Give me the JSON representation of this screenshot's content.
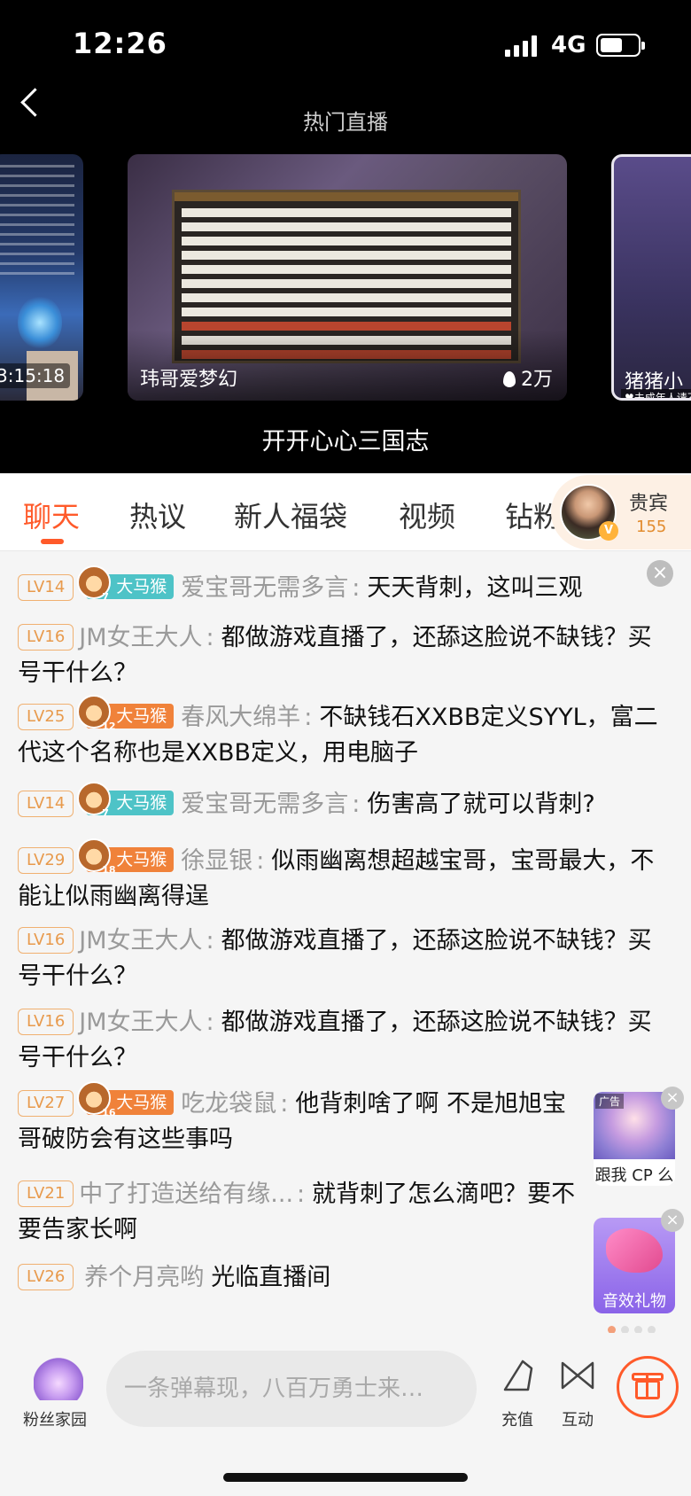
{
  "status_bar": {
    "time": "12:26",
    "network": "4G",
    "battery_level": 0.6
  },
  "header": {
    "title": "热门直播"
  },
  "carousel": {
    "left_card": {
      "timer": "3:15:18"
    },
    "main_card": {
      "streamer": "玮哥爱梦幻",
      "heat": "2万"
    },
    "right_card": {
      "streamer": "猪猪小",
      "badge": "♥未成年人请不"
    },
    "room_title": "开开心心三国志"
  },
  "tabs": [
    {
      "label": "聊天",
      "active": true
    },
    {
      "label": "热议"
    },
    {
      "label": "新人福袋"
    },
    {
      "label": "视频"
    },
    {
      "label": "钻粉"
    }
  ],
  "vip": {
    "label": "贵宾",
    "count": "155"
  },
  "chat": {
    "messages": [
      {
        "level": "LV14",
        "fan_badge": "大马猴",
        "fan_level": "7",
        "nick": "爱宝哥无需多言",
        "text": "天天背刺，这叫三观"
      },
      {
        "level": "LV16",
        "nick": "JM女王大人",
        "text": "都做游戏直播了，还舔这脸说不缺钱？买号干什么？"
      },
      {
        "level": "LV25",
        "fan_badge": "大马猴",
        "fan_level": "12",
        "nick": "春风大绵羊",
        "text": "不缺钱石XXBB定义SYYL，富二代这个名称也是XXBB定义，用电脑子"
      },
      {
        "level": "LV14",
        "fan_badge": "大马猴",
        "fan_level": "7",
        "nick": "爱宝哥无需多言",
        "text": "伤害高了就可以背刺?"
      },
      {
        "level": "LV29",
        "fan_badge": "大马猴",
        "fan_level": "18",
        "nick": "徐显银",
        "text": "似雨幽离想超越宝哥，宝哥最大，不能让似雨幽离得逞"
      },
      {
        "level": "LV16",
        "nick": "JM女王大人",
        "text": "都做游戏直播了，还舔这脸说不缺钱？买号干什么？"
      },
      {
        "level": "LV16",
        "nick": "JM女王大人",
        "text": "都做游戏直播了，还舔这脸说不缺钱？买号干什么？"
      },
      {
        "level": "LV27",
        "fan_badge": "大马猴",
        "fan_level": "16",
        "nick": "吃龙袋鼠",
        "text": "他背刺啥了啊 不是旭旭宝哥破防会有这些事吗"
      },
      {
        "level": "LV21",
        "nick": "中了打造送给有缘...",
        "text": "就背刺了怎么滴吧？要不要告家长啊"
      },
      {
        "level": "LV26",
        "nick": "养个月亮哟",
        "text": "光临直播间"
      }
    ]
  },
  "ads": [
    {
      "tag": "广告",
      "caption": "跟我 CP 么"
    },
    {
      "caption": "音效礼物"
    }
  ],
  "bottom_bar": {
    "fans_home_label": "粉丝家园",
    "input_placeholder": "一条弹幕现，八百万勇士来…",
    "recharge_label": "充值",
    "interact_label": "互动"
  },
  "colors": {
    "accent": "#ff5a2a",
    "level_badge": "#e89a4c",
    "fan_badge_teal": "#4ec3c7",
    "fan_badge_orange": "#f0823a"
  }
}
